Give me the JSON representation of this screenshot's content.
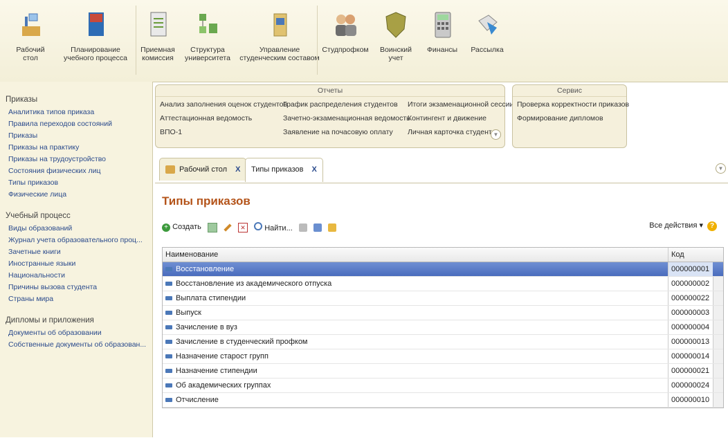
{
  "toolbar": {
    "items": [
      {
        "label": "Рабочий\nстол",
        "icon": "desk-icon"
      },
      {
        "label": "Планирование\nучебного процесса",
        "icon": "book-icon"
      },
      {
        "label": "Приемная\nкомиссия",
        "icon": "clipboard-icon"
      },
      {
        "label": "Структура\nуниверситета",
        "icon": "org-chart-icon"
      },
      {
        "label": "Управление\nстуденческим составом",
        "icon": "id-card-icon"
      },
      {
        "label": "Студпрофком",
        "icon": "people-icon"
      },
      {
        "label": "Воинский\nучет",
        "icon": "shield-icon"
      },
      {
        "label": "Финансы",
        "icon": "calculator-icon"
      },
      {
        "label": "Рассылка",
        "icon": "envelope-icon"
      }
    ]
  },
  "sidebar": {
    "sections": [
      {
        "title": "Приказы",
        "items": [
          "Аналитика типов приказа",
          "Правила переходов состояний",
          "Приказы",
          "Приказы на практику",
          "Приказы на трудоустройство",
          "Состояния физических лиц",
          "Типы приказов",
          "Физические лица"
        ]
      },
      {
        "title": "Учебный процесс",
        "items": [
          "Виды образований",
          "Журнал учета образовательного проц...",
          "Зачетные книги",
          "Иностранные языки",
          "Национальности",
          "Причины вызова студента",
          "Страны мира"
        ]
      },
      {
        "title": "Дипломы и приложения",
        "items": [
          "Документы об образовании",
          "Собственные документы об образован..."
        ]
      }
    ]
  },
  "reports": {
    "title": "Отчеты",
    "col1": [
      "Анализ заполнения оценок студентов",
      "Аттестационная ведомость",
      "ВПО-1"
    ],
    "col2": [
      "График распределения студентов",
      "Зачетно-экзаменационная ведомость",
      "Заявление на почасовую оплату"
    ],
    "col3": [
      "Итоги экзаменационной сессии",
      "Контингент и движение",
      "Личная карточка студента"
    ]
  },
  "service": {
    "title": "Сервис",
    "items": [
      "Проверка корректности приказов",
      "Формирование дипломов"
    ]
  },
  "tabs": [
    {
      "label": "Рабочий стол",
      "close": "X"
    },
    {
      "label": "Типы приказов",
      "close": "X"
    }
  ],
  "page": {
    "title": "Типы приказов",
    "create": "Создать",
    "find": "Найти...",
    "all_actions": "Все действия ▾",
    "help": "?"
  },
  "table": {
    "headers": {
      "name": "Наименование",
      "code": "Код"
    },
    "rows": [
      {
        "name": "Восстановление",
        "code": "000000001"
      },
      {
        "name": "Восстановление из академического отпуска",
        "code": "000000002"
      },
      {
        "name": "Выплата стипендии",
        "code": "000000022"
      },
      {
        "name": "Выпуск",
        "code": "000000003"
      },
      {
        "name": "Зачисление в вуз",
        "code": "000000004"
      },
      {
        "name": "Зачисление в студенческий профком",
        "code": "000000013"
      },
      {
        "name": "Назначение старост групп",
        "code": "000000014"
      },
      {
        "name": "Назначение стипендии",
        "code": "000000021"
      },
      {
        "name": "Об академических группах",
        "code": "000000024"
      },
      {
        "name": "Отчисление",
        "code": "000000010"
      }
    ]
  },
  "colors": {
    "accent": "#b4541a",
    "selection": "#4a6cbd",
    "link": "#2a4a8c"
  }
}
